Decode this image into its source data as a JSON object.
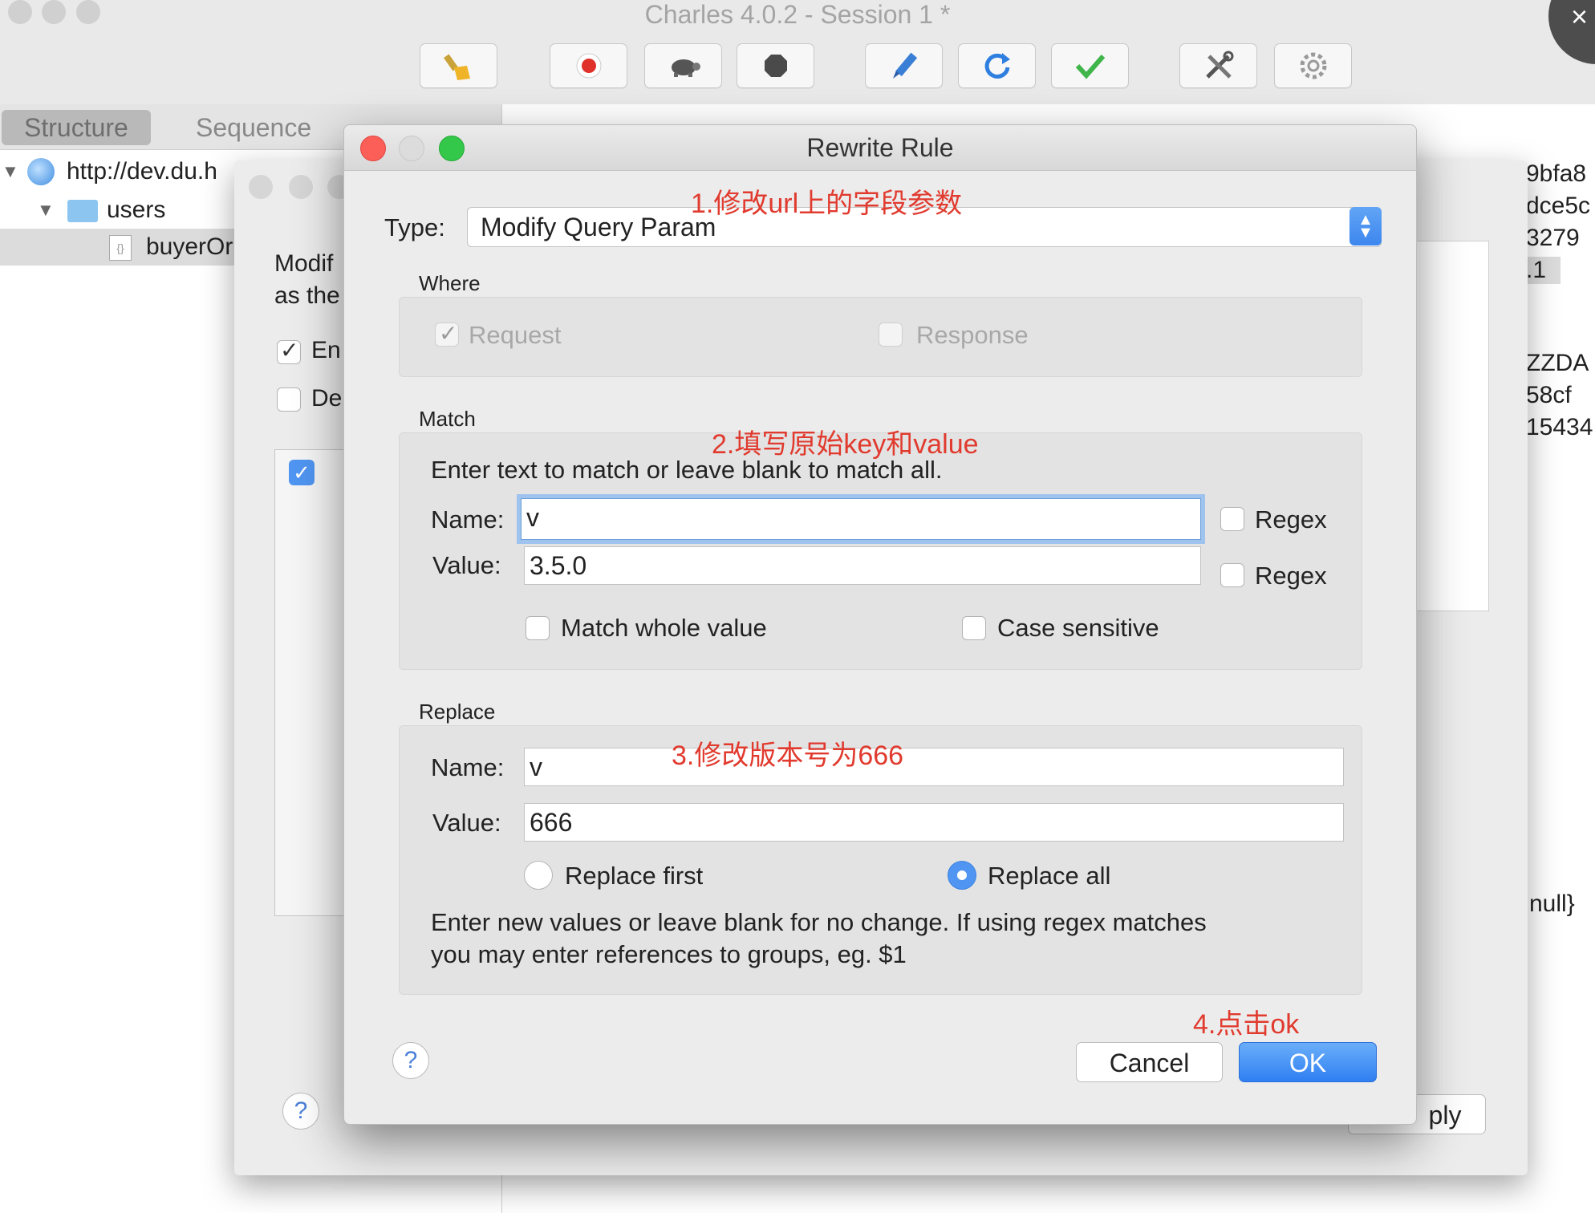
{
  "window": {
    "title": "Charles 4.0.2 - Session 1 *",
    "toolbar": [
      {
        "icon": "broom-icon"
      },
      {
        "icon": "record-icon"
      },
      {
        "icon": "turtle-icon"
      },
      {
        "icon": "stop-icon"
      },
      {
        "icon": "pen-icon"
      },
      {
        "icon": "refresh-icon"
      },
      {
        "icon": "check-icon"
      },
      {
        "icon": "tools-icon"
      },
      {
        "icon": "gear-icon"
      }
    ]
  },
  "left_panel": {
    "tabs": [
      "Structure",
      "Sequence"
    ],
    "tree": {
      "host": "http://dev.du.h",
      "folder": "users",
      "file": "buyerOr"
    }
  },
  "right_panel": {
    "fragments": [
      "9bfa8",
      "dce5c",
      "3279",
      ".1",
      "ZZDA",
      "58cf",
      "15434",
      "null}",
      "ply"
    ]
  },
  "background_dialog": {
    "text_line1": "Modif",
    "text_line2": "as the",
    "enable_label": "En",
    "disable_label": "De",
    "help": "?"
  },
  "rewrite_rule": {
    "title": "Rewrite Rule",
    "type_label": "Type:",
    "type_value": "Modify Query Param",
    "where": {
      "heading": "Where",
      "request_label": "Request",
      "response_label": "Response"
    },
    "match": {
      "heading": "Match",
      "hint": "Enter text to match or leave blank to match all.",
      "name_label": "Name:",
      "name_value": "v",
      "value_label": "Value:",
      "value_value": "3.5.0",
      "regex_label": "Regex",
      "match_whole_label": "Match whole value",
      "case_sensitive_label": "Case sensitive"
    },
    "replace": {
      "heading": "Replace",
      "name_label": "Name:",
      "name_value": "v",
      "value_label": "Value:",
      "value_value": "666",
      "replace_first_label": "Replace first",
      "replace_all_label": "Replace all",
      "hint_line1": "Enter new values or leave blank for no change. If using regex matches",
      "hint_line2": "you may enter references to groups, eg. $1"
    },
    "buttons": {
      "help": "?",
      "cancel": "Cancel",
      "ok": "OK"
    }
  },
  "annotations": {
    "step1": "1.修改url上的字段参数",
    "step2": "2.填写原始key和value",
    "step3": "3.修改版本号为666",
    "step4": "4.点击ok",
    "color": "#e13a2e"
  }
}
